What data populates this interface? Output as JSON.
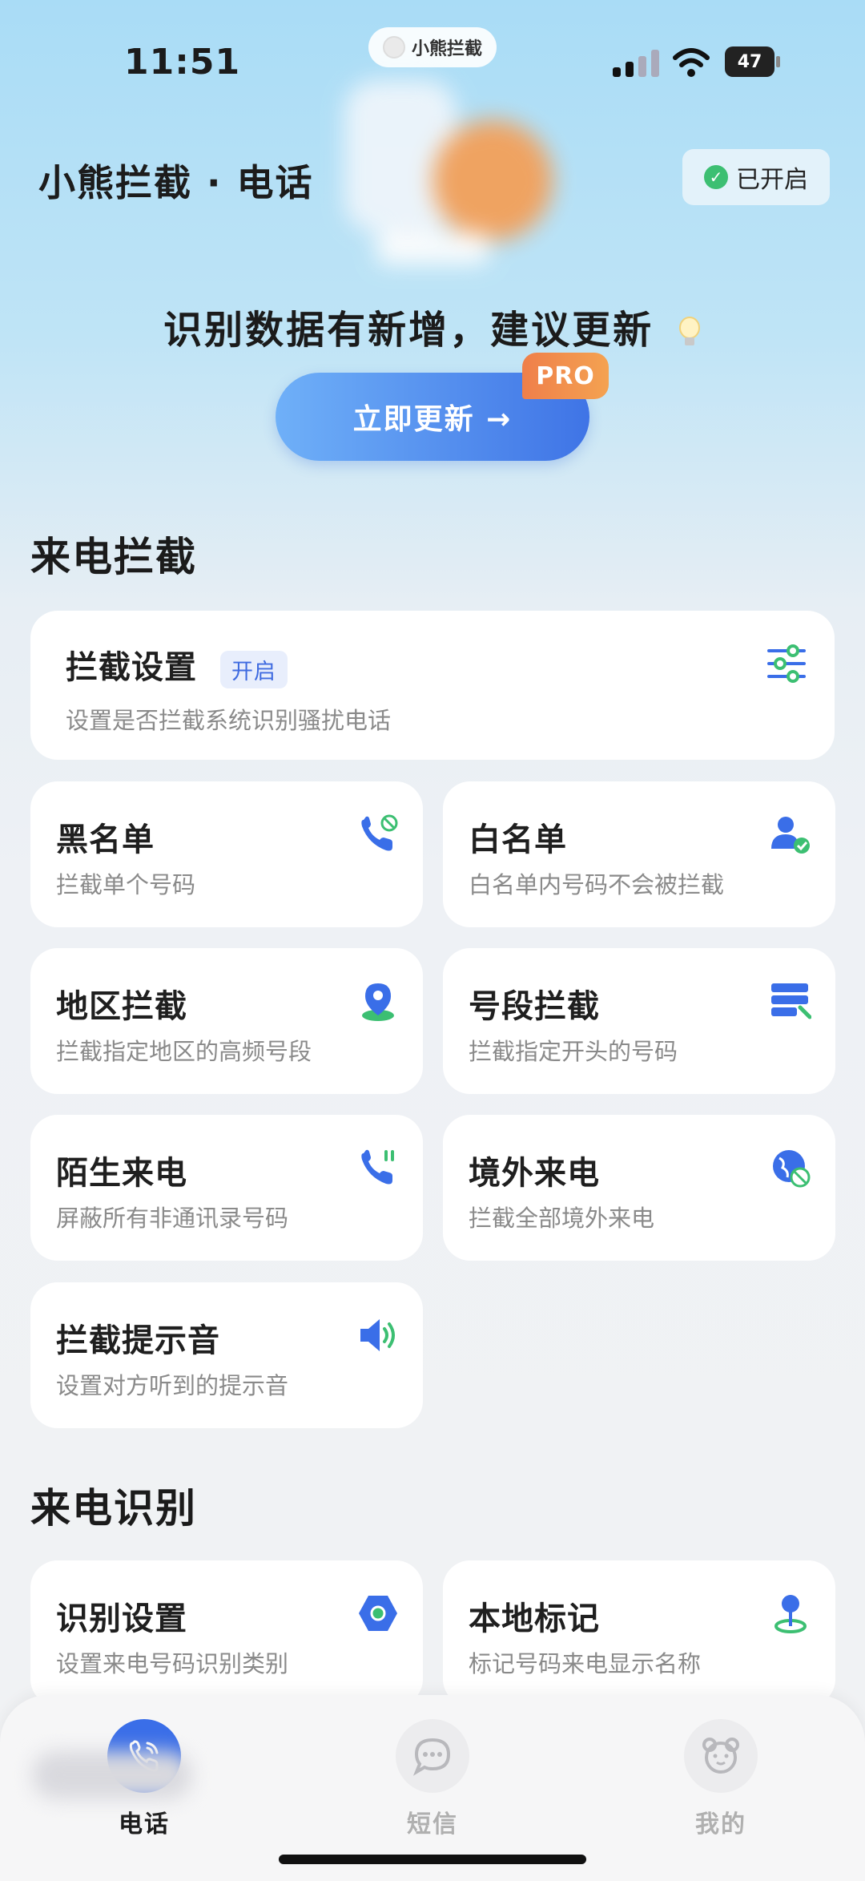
{
  "status_bar": {
    "time": "11:51",
    "island_app": "小熊拦截",
    "battery": "47"
  },
  "header": {
    "title": "小熊拦截 · 电话",
    "status": "已开启"
  },
  "update": {
    "message": "识别数据有新增，建议更新",
    "button": "立即更新 →",
    "badge": "PRO"
  },
  "sections": {
    "intercept": "来电拦截",
    "identify": "来电识别"
  },
  "intercept_settings": {
    "title": "拦截设置",
    "state": "开启",
    "subtitle": "设置是否拦截系统识别骚扰电话",
    "icon": "sliders-icon"
  },
  "cards": [
    {
      "title": "黑名单",
      "subtitle": "拦截单个号码",
      "icon": "blocked-call-icon"
    },
    {
      "title": "白名单",
      "subtitle": "白名单内号码不会被拦截",
      "icon": "user-check-icon"
    },
    {
      "title": "地区拦截",
      "subtitle": "拦截指定地区的高频号段",
      "icon": "location-pin-icon"
    },
    {
      "title": "号段拦截",
      "subtitle": "拦截指定开头的号码",
      "icon": "number-range-icon"
    },
    {
      "title": "陌生来电",
      "subtitle": "屏蔽所有非通讯录号码",
      "icon": "pause-call-icon"
    },
    {
      "title": "境外来电",
      "subtitle": "拦截全部境外来电",
      "icon": "globe-block-icon"
    },
    {
      "title": "拦截提示音",
      "subtitle": "设置对方听到的提示音",
      "icon": "speaker-icon"
    }
  ],
  "identify_cards": [
    {
      "title": "识别设置",
      "subtitle": "设置来电号码识别类别",
      "icon": "hexagon-icon"
    },
    {
      "title": "本地标记",
      "subtitle": "标记号码来电显示名称",
      "icon": "map-pin-icon"
    }
  ],
  "tabs": [
    {
      "label": "电话",
      "icon": "phone-icon",
      "active": true
    },
    {
      "label": "短信",
      "icon": "message-icon",
      "active": false
    },
    {
      "label": "我的",
      "icon": "bear-icon",
      "active": false
    }
  ],
  "colors": {
    "accent": "#3a6ee8",
    "green": "#3cbf72",
    "pro": "#ef7f4a"
  }
}
